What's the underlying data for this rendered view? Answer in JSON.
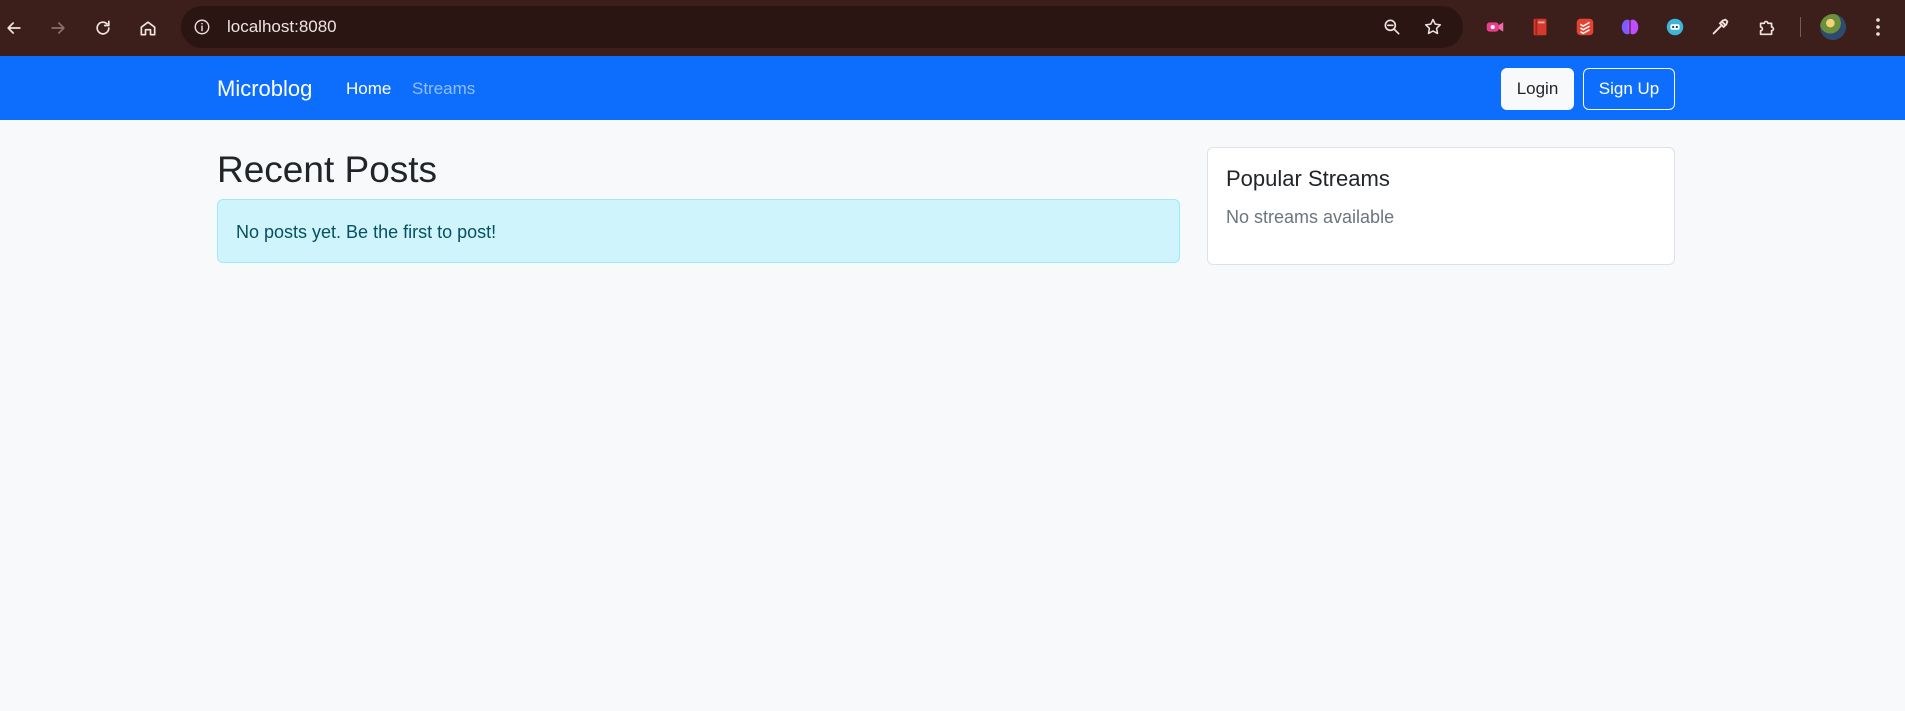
{
  "browser": {
    "url": "localhost:8080",
    "back_icon": "arrow-left-icon",
    "forward_icon": "arrow-right-icon",
    "reload_icon": "reload-icon",
    "home_icon": "home-icon",
    "site_info_icon": "info-icon",
    "zoom_icon": "zoom-out-icon",
    "bookmark_icon": "star-icon",
    "extensions": [
      "video-extension-icon",
      "book-extension-icon",
      "todoist-extension-icon",
      "brain-extension-icon",
      "robot-extension-icon",
      "eyedropper-extension-icon",
      "puzzle-extensions-icon"
    ],
    "toolbar_color": "#3c1f1b"
  },
  "navbar": {
    "brand": "Microblog",
    "links": [
      {
        "label": "Home",
        "active": true
      },
      {
        "label": "Streams",
        "active": false
      }
    ],
    "login_label": "Login",
    "signup_label": "Sign Up",
    "color": "#0d6efd"
  },
  "main": {
    "title": "Recent Posts",
    "empty_message": "No posts yet. Be the first to post!"
  },
  "sidebar": {
    "card_title": "Popular Streams",
    "card_text": "No streams available"
  }
}
